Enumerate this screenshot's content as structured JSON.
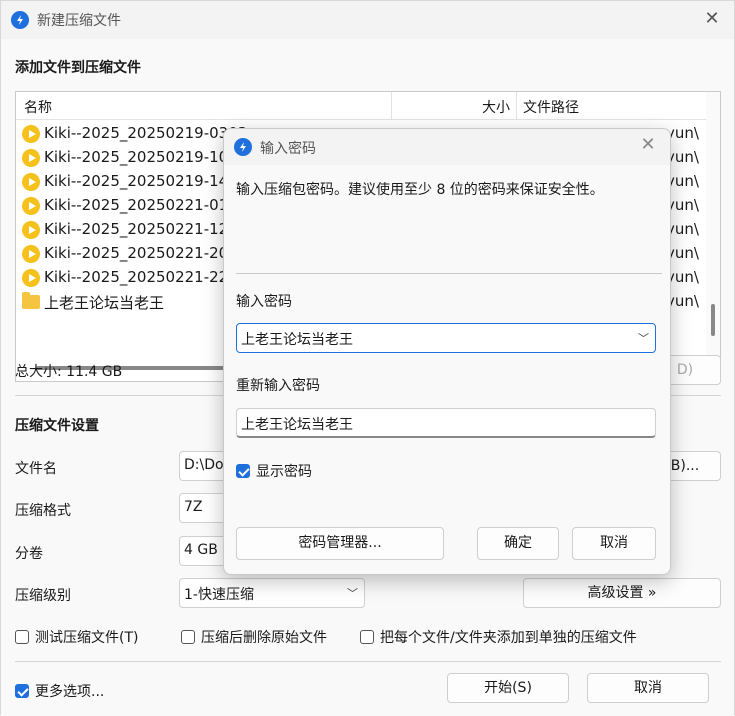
{
  "window": {
    "title": "新建压缩文件",
    "close_glyph": "✕"
  },
  "files_section": {
    "title": "添加文件到压缩文件",
    "headers": {
      "name": "名称",
      "size": "大小",
      "path": "文件路径"
    },
    "rows": [
      {
        "name": "Kiki--2025_20250219-0303...",
        "type": "video",
        "path_tail": "yun\\"
      },
      {
        "name": "Kiki--2025_20250219-106",
        "type": "video",
        "path_tail": "yun\\"
      },
      {
        "name": "Kiki--2025_20250219-141",
        "type": "video",
        "path_tail": "yun\\"
      },
      {
        "name": "Kiki--2025_20250221-014",
        "type": "video",
        "path_tail": "yun\\"
      },
      {
        "name": "Kiki--2025_20250221-120",
        "type": "video",
        "path_tail": "yun\\"
      },
      {
        "name": "Kiki--2025_20250221-206",
        "type": "video",
        "path_tail": "yun\\"
      },
      {
        "name": "Kiki--2025_20250221-224",
        "type": "video",
        "path_tail": "yun\\"
      },
      {
        "name": "上老王论坛当老王",
        "type": "folder",
        "path_tail": "yun\\"
      }
    ],
    "total_size": "总大小: 11.4 GB",
    "partial_button": "D)"
  },
  "settings": {
    "title": "压缩文件设置",
    "filename_label": "文件名",
    "filename_value": "D:\\Do",
    "browse_button": "B)...",
    "format_label": "压缩格式",
    "format_value": "7Z",
    "split_label": "分卷",
    "split_value": "4 GB (",
    "level_label": "压缩级别",
    "level_value": "1-快速压缩",
    "advanced_button": "高级设置 »",
    "check_test": "测试压缩文件(T)",
    "check_delete": "压缩后删除原始文件",
    "check_each": "把每个文件/文件夹添加到单独的压缩文件"
  },
  "footer": {
    "more_options": "更多选项...",
    "start_button": "开始(S)",
    "cancel_button": "取消"
  },
  "modal": {
    "title": "输入密码",
    "description": "输入压缩包密码。建议使用至少 8 位的密码来保证安全性。",
    "password_label": "输入密码",
    "password_value": "上老王论坛当老王",
    "confirm_label": "重新输入密码",
    "confirm_value": "上老王论坛当老王",
    "show_password": "显示密码",
    "manager_button": "密码管理器...",
    "ok_button": "确定",
    "cancel_button": "取消"
  },
  "colors": {
    "accent": "#1f6fdc",
    "video_icon": "#f4c21b",
    "folder_icon": "#f5c542"
  }
}
